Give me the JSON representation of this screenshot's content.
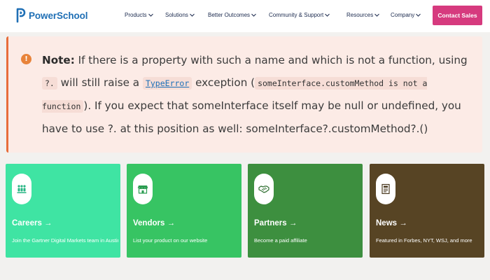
{
  "header": {
    "logo_text": "PowerSchool",
    "nav": [
      "Products",
      "Solutions",
      "Better Outcomes",
      "Community & Support",
      "Resources",
      "Company"
    ],
    "contact_label": "Contact Sales"
  },
  "note": {
    "icon": "!",
    "label": "Note:",
    "text_1": " If there is a property with such a name and which is not a function, using ",
    "code_1": "?.",
    "text_2": " will still raise a ",
    "link_code": "TypeError",
    "text_3": " exception (",
    "code_2": "someInterface.customMethod is not a function",
    "text_4": "). If you expect that someInterface itself may be null or undefined, you have to use ?. at this position as well: someInterface?.customMethod?.()"
  },
  "cards": [
    {
      "title": "Careers →",
      "desc": "Join the Gartner Digital Markets team in Austin",
      "icon": "people-icon",
      "color": "#3fe4a3"
    },
    {
      "title": "Vendors →",
      "desc": "List your product on our website",
      "icon": "storefront-icon",
      "color": "#37c463"
    },
    {
      "title": "Partners →",
      "desc": "Become a paid affiliate",
      "icon": "handshake-icon",
      "color": "#3d8f3f"
    },
    {
      "title": "News →",
      "desc": "Featured in Forbes, NYT, WSJ, and more",
      "icon": "newspaper-icon",
      "color": "#574424"
    }
  ]
}
